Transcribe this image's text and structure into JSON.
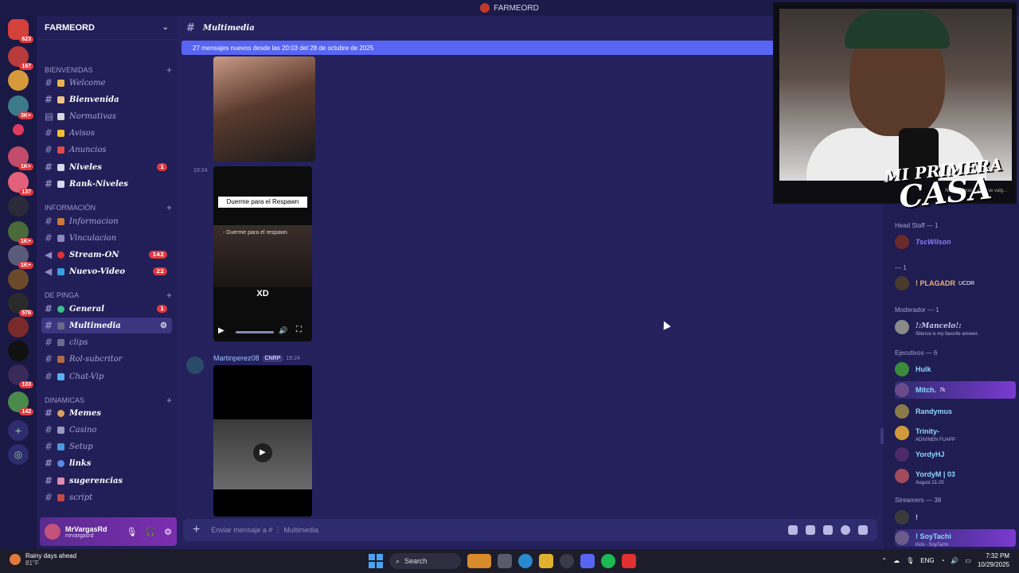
{
  "window": {
    "title": "FARMEORD"
  },
  "rail": {
    "badges": [
      "623",
      "167",
      "3K+",
      "1K+",
      "137",
      "1K+",
      "1K+",
      "576",
      "103",
      "142"
    ]
  },
  "sidebar": {
    "server_name": "FARMEORD",
    "categories": [
      {
        "label": "BIENVENIDAS"
      },
      {
        "label": "INFORMACIÓN"
      },
      {
        "label": "DE PINGA"
      },
      {
        "label": "DINAMICAS"
      }
    ],
    "channels": [
      {
        "label": "Welcome"
      },
      {
        "label": "Bienvenida"
      },
      {
        "label": "Normativas"
      },
      {
        "label": "Avisos"
      },
      {
        "label": "Anuncios"
      },
      {
        "label": "Niveles",
        "badge": "1"
      },
      {
        "label": "Rank-Niveles"
      },
      {
        "label": "Informacion"
      },
      {
        "label": "Vinculacion"
      },
      {
        "label": "Stream-ON",
        "badge": "142"
      },
      {
        "label": "Nuevo-Video",
        "badge": "22"
      },
      {
        "label": "General",
        "badge": "1"
      },
      {
        "label": "Multimedia"
      },
      {
        "label": "clips"
      },
      {
        "label": "Rol-subcritor"
      },
      {
        "label": "Chat-Vip"
      },
      {
        "label": "Memes"
      },
      {
        "label": "Casino"
      },
      {
        "label": "Setup"
      },
      {
        "label": "links"
      },
      {
        "label": "sugerencias"
      },
      {
        "label": "script"
      }
    ],
    "user": {
      "name": "MrVargasRd",
      "handle": "mrvargasrd"
    }
  },
  "main": {
    "channel_title": "Multimedia",
    "new_messages_bar": "27 mensajes nuevos desde las 20:03 del 28 de octubre de 2025",
    "timestamp_1": "19:24",
    "video_caption_top": "Duerme para el Respawn",
    "video_caption_mid": "- Duerme para el respawn",
    "video_caption_bottom": "XD",
    "author": {
      "name": "Martinperez08",
      "tag": "CNRP",
      "time": "19:24"
    },
    "composer_placeholder": "Enviar mensaje a #  ⋮ Multimedia"
  },
  "webcam": {
    "overlay_line1": "MI PRIMERA",
    "overlay_line2": "CASA",
    "ticker": "No consigue nada que valg..."
  },
  "members": {
    "groups": [
      {
        "label": "Head Staff — 1"
      },
      {
        "label": "— 1"
      },
      {
        "label": "Moderador — 1"
      },
      {
        "label": "Ejecutivos — 6"
      },
      {
        "label": "Streamers — 38"
      }
    ],
    "list": [
      {
        "name": "TscWilson",
        "sub": "",
        "color": "#8b7bff"
      },
      {
        "name": "! PLAGADR",
        "sub": "",
        "tag": "UCDR",
        "color": "#e8b27a"
      },
      {
        "name": "!:Mancelo!:",
        "sub": "Silence is my favorite answer.",
        "color": "#c9c7ee"
      },
      {
        "name": "Hulk",
        "sub": "",
        "color": "#8fd7ff"
      },
      {
        "name": "Mitch.",
        "sub": "",
        "tag": "7k",
        "color": "#8fd7ff"
      },
      {
        "name": "Randymus",
        "sub": "",
        "color": "#8fd7ff"
      },
      {
        "name": "Trinity-",
        "sub": "ADIVINEN FUAPP",
        "color": "#8fd7ff"
      },
      {
        "name": "YordyHJ",
        "sub": "",
        "color": "#8fd7ff"
      },
      {
        "name": "YordyM | 03",
        "sub": "August 21-25",
        "color": "#8fd7ff"
      },
      {
        "name": "!",
        "sub": "",
        "color": "#c9c7ee"
      },
      {
        "name": "! SoyTachi",
        "sub": "Kick - SoyTachi",
        "color": "#8fd7ff"
      }
    ]
  },
  "taskbar": {
    "weather_title": "Rainy days ahead",
    "weather_temp": "81°F",
    "search": "Search",
    "lang": "ENG",
    "time": "7:32 PM",
    "date": "10/29/2025"
  }
}
